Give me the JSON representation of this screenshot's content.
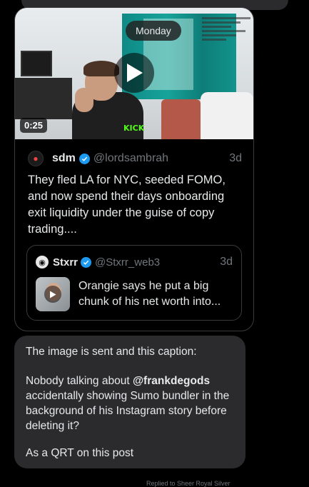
{
  "chat": {
    "date_separator": "Monday"
  },
  "shared_post": {
    "video": {
      "duration": "0:25",
      "watermark": "KICK"
    },
    "author": {
      "name": "sdm",
      "handle": "@lordsambrah",
      "time": "3d"
    },
    "text": "They fled LA for NYC, seeded FOMO, and now spend their days onboarding exit liquidity under the guise of copy trading....",
    "quoted": {
      "name": "Stxrr",
      "handle": "@Stxrr_web3",
      "time": "3d",
      "text": "Orangie says he put a big chunk of his net worth into..."
    }
  },
  "message": {
    "line1": "The image is sent and this caption:",
    "mention": "@frankdegods",
    "before_mention": "Nobody talking about ",
    "after_mention": " accidentally showing Sumo bundler in the background of his Instagram story before deleting it?",
    "line3": "As a QRT on this post"
  },
  "footer": {
    "text": "Replied to Sheer Royal Silver"
  },
  "icons": {
    "play": "play-icon",
    "verified": "verified-badge-icon"
  },
  "colors": {
    "background": "#000000",
    "bubble": "#2b2b2e",
    "verified": "#1d9bf0",
    "muted": "#71767b"
  }
}
